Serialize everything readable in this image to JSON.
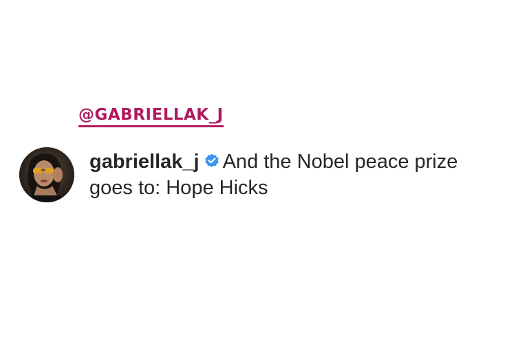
{
  "mention": {
    "tag_text": "@GABRIELLAK_J",
    "color": "#b0195f"
  },
  "comment": {
    "username": "gabriellak_j",
    "verified_badge": {
      "icon": "verified-badge-icon",
      "color": "#3897f0"
    },
    "text": "And the Nobel peace prize goes to: Hope Hicks",
    "avatar": {
      "icon": "profile-avatar"
    }
  }
}
